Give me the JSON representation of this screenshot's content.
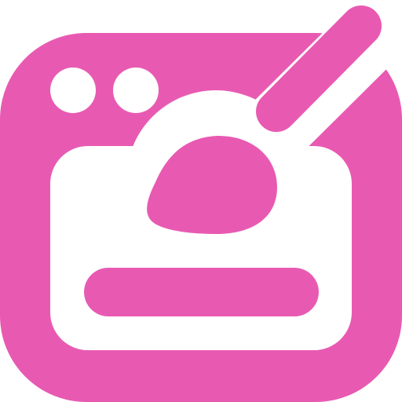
{
  "icon": {
    "name": "web-design-paintbrush-icon",
    "accent_color": "#E85AB2",
    "background_color": "#FFFFFF"
  }
}
